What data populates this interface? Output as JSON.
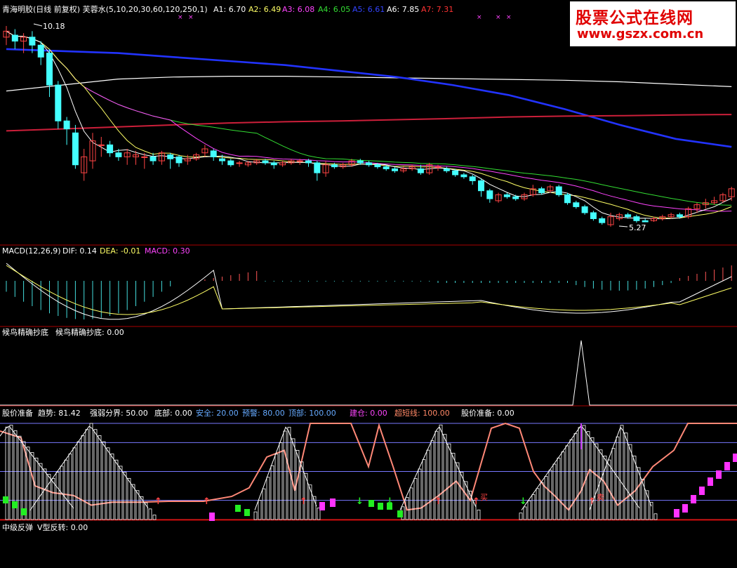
{
  "header": {
    "title": "青海明胶(日线 前复权) 芙蓉水(5,10,20,30,60,120,250,1)",
    "ma_values": [
      {
        "label": "A1: 6.70",
        "color": "#ffffff"
      },
      {
        "label": "A2: 6.49",
        "color": "#ffff66"
      },
      {
        "label": "A3: 6.08",
        "color": "#ff44ff"
      },
      {
        "label": "A4: 6.05",
        "color": "#33dd33"
      },
      {
        "label": "A5: 6.61",
        "color": "#3344ff"
      },
      {
        "label": "A6: 7.85",
        "color": "#ffffff"
      },
      {
        "label": "A7: 7.31",
        "color": "#ff3333"
      }
    ]
  },
  "logo": {
    "line1": "股票公式在线网",
    "line2": "www.gszx.com.cn"
  },
  "price_labels": {
    "high": "10.18",
    "low": "5.27"
  },
  "macd": {
    "name": "MACD(12,26,9)",
    "dif": "DIF: 0.14",
    "dea": "DEA: -0.01",
    "macd": "MACD: 0.30",
    "colors": {
      "dif": "#ffffff",
      "dea": "#ffff66",
      "macd": "#ff44ff"
    }
  },
  "panel3": {
    "title": "候鸟精确抄底",
    "value": "候鸟精确抄底: 0.00"
  },
  "panel4": {
    "items": [
      {
        "label": "股价准备",
        "color": "#ffffff"
      },
      {
        "label": "趋势: 81.42",
        "color": "#ffffff"
      },
      {
        "label": "强弱分界: 50.00",
        "color": "#ffffff"
      },
      {
        "label": "底部: 0.00",
        "color": "#ffffff"
      },
      {
        "label": "安全: 20.00",
        "color": "#66aaff"
      },
      {
        "label": "预警: 80.00",
        "color": "#66aaff"
      },
      {
        "label": "顶部: 100.00",
        "color": "#66aaff"
      },
      {
        "label": "建仓: 0.00",
        "color": "#ff44ff"
      },
      {
        "label": "超短线: 100.00",
        "color": "#ff8866"
      },
      {
        "label": "股价准备: 0.00",
        "color": "#ffffff"
      }
    ],
    "annotations": [
      "买",
      "卖"
    ]
  },
  "panel5": {
    "title": "中级反弹",
    "value": "V型反转: 0.00"
  },
  "colors": {
    "up": "#ff4444",
    "down": "#44ffff",
    "separator": "#aa0000"
  },
  "chart_data": {
    "type": "candlestick",
    "price_axis_hint": "price ≈ 5.27 to 10.18",
    "candles": [
      [
        9.9,
        10.05,
        9.7,
        10.18
      ],
      [
        9.95,
        9.8,
        9.6,
        10.1
      ],
      [
        9.8,
        9.9,
        9.5,
        10.0
      ],
      [
        9.9,
        9.7,
        9.5,
        10.05
      ],
      [
        9.7,
        9.4,
        9.2,
        9.8
      ],
      [
        9.5,
        8.7,
        8.4,
        9.6
      ],
      [
        8.7,
        7.8,
        7.6,
        8.8
      ],
      [
        7.8,
        7.6,
        7.2,
        7.9
      ],
      [
        7.5,
        6.7,
        6.6,
        7.7
      ],
      [
        6.5,
        6.9,
        6.3,
        7.1
      ],
      [
        6.8,
        7.3,
        6.6,
        7.5
      ],
      [
        7.2,
        7.2,
        6.9,
        7.4
      ],
      [
        7.2,
        7.0,
        6.9,
        7.3
      ],
      [
        7.0,
        6.9,
        6.8,
        7.1
      ],
      [
        6.9,
        7.0,
        6.7,
        7.1
      ],
      [
        6.9,
        6.95,
        6.7,
        7.05
      ],
      [
        6.9,
        6.9,
        6.6,
        7.0
      ],
      [
        6.9,
        6.8,
        6.7,
        7.0
      ],
      [
        6.8,
        7.0,
        6.7,
        7.05
      ],
      [
        6.95,
        6.85,
        6.6,
        7.0
      ],
      [
        6.9,
        6.75,
        6.65,
        6.95
      ],
      [
        6.8,
        6.85,
        6.7,
        6.95
      ],
      [
        6.85,
        6.95,
        6.8,
        7.0
      ],
      [
        7.0,
        7.1,
        6.9,
        7.2
      ],
      [
        7.05,
        6.9,
        6.8,
        7.1
      ],
      [
        6.85,
        6.8,
        6.7,
        6.95
      ],
      [
        6.8,
        6.7,
        6.65,
        6.85
      ],
      [
        6.75,
        6.75,
        6.65,
        6.8
      ],
      [
        6.7,
        6.75,
        6.65,
        6.8
      ],
      [
        6.75,
        6.8,
        6.7,
        6.85
      ],
      [
        6.8,
        6.75,
        6.7,
        6.85
      ],
      [
        6.75,
        6.7,
        6.6,
        6.8
      ],
      [
        6.7,
        6.75,
        6.65,
        6.8
      ],
      [
        6.75,
        6.8,
        6.7,
        6.85
      ],
      [
        6.8,
        6.8,
        6.7,
        6.85
      ],
      [
        6.8,
        6.75,
        6.65,
        6.85
      ],
      [
        6.75,
        6.5,
        6.3,
        6.8
      ],
      [
        6.5,
        6.7,
        6.4,
        6.8
      ],
      [
        6.7,
        6.65,
        6.6,
        6.75
      ],
      [
        6.65,
        6.7,
        6.6,
        6.75
      ],
      [
        6.7,
        6.8,
        6.65,
        6.85
      ],
      [
        6.8,
        6.75,
        6.7,
        6.85
      ],
      [
        6.75,
        6.7,
        6.65,
        6.8
      ],
      [
        6.7,
        6.65,
        6.6,
        6.75
      ],
      [
        6.65,
        6.6,
        6.55,
        6.7
      ],
      [
        6.6,
        6.55,
        6.5,
        6.65
      ],
      [
        6.55,
        6.6,
        6.5,
        6.65
      ],
      [
        6.6,
        6.65,
        6.55,
        6.7
      ],
      [
        6.6,
        6.5,
        6.45,
        6.7
      ],
      [
        6.5,
        6.7,
        6.45,
        6.75
      ],
      [
        6.65,
        6.65,
        6.55,
        6.7
      ],
      [
        6.6,
        6.55,
        6.5,
        6.65
      ],
      [
        6.55,
        6.45,
        6.4,
        6.6
      ],
      [
        6.45,
        6.4,
        6.35,
        6.5
      ],
      [
        6.4,
        6.3,
        6.2,
        6.45
      ],
      [
        6.3,
        6.05,
        5.9,
        6.35
      ],
      [
        6.05,
        5.85,
        5.75,
        6.1
      ],
      [
        5.8,
        5.95,
        5.75,
        6.0
      ],
      [
        5.95,
        5.9,
        5.85,
        6.0
      ],
      [
        5.9,
        5.85,
        5.8,
        5.95
      ],
      [
        5.85,
        5.95,
        5.8,
        6.0
      ],
      [
        5.95,
        6.1,
        5.9,
        6.2
      ],
      [
        6.1,
        6.0,
        5.95,
        6.15
      ],
      [
        6.05,
        6.15,
        6.0,
        6.2
      ],
      [
        6.15,
        5.95,
        5.9,
        6.2
      ],
      [
        5.95,
        5.75,
        5.7,
        6.0
      ],
      [
        5.75,
        5.65,
        5.6,
        5.8
      ],
      [
        5.65,
        5.5,
        5.45,
        5.7
      ],
      [
        5.5,
        5.35,
        5.3,
        5.55
      ],
      [
        5.35,
        5.25,
        5.2,
        5.4
      ],
      [
        5.2,
        5.4,
        5.15,
        5.5
      ],
      [
        5.35,
        5.45,
        5.3,
        5.5
      ],
      [
        5.45,
        5.4,
        5.35,
        5.5
      ],
      [
        5.4,
        5.3,
        5.25,
        5.45
      ],
      [
        5.3,
        5.27,
        5.27,
        5.35
      ],
      [
        5.3,
        5.35,
        5.27,
        5.4
      ],
      [
        5.35,
        5.4,
        5.3,
        5.45
      ],
      [
        5.4,
        5.45,
        5.35,
        5.5
      ],
      [
        5.45,
        5.4,
        5.35,
        5.5
      ],
      [
        5.4,
        5.6,
        5.35,
        5.65
      ],
      [
        5.6,
        5.7,
        5.5,
        5.75
      ],
      [
        5.7,
        5.75,
        5.6,
        5.85
      ],
      [
        5.75,
        5.8,
        5.7,
        5.9
      ],
      [
        5.8,
        5.95,
        5.75,
        6.0
      ],
      [
        5.9,
        6.1,
        5.8,
        6.15
      ]
    ]
  }
}
